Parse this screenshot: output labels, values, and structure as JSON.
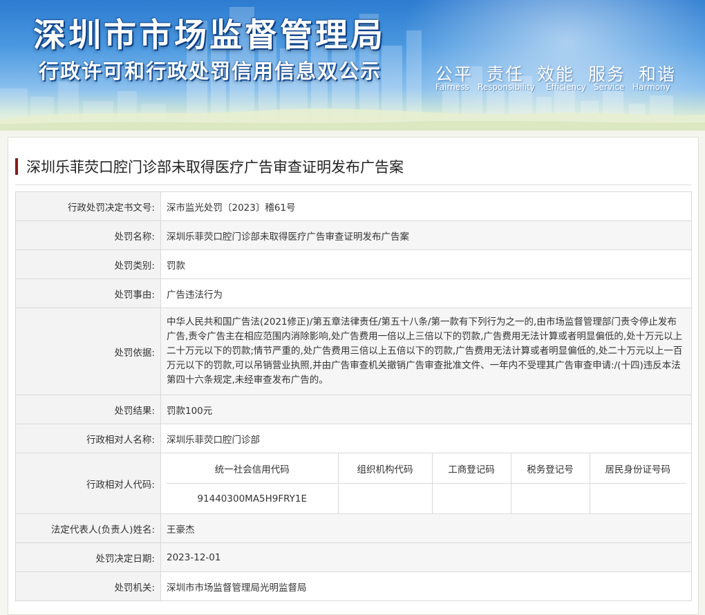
{
  "header": {
    "title": "深圳市市场监督管理局",
    "subtitle": "行政许可和行政处罚信用信息双公示",
    "slogans": [
      {
        "cn": "公平",
        "en": "Fairness"
      },
      {
        "cn": "责任",
        "en": "Responsibility"
      },
      {
        "cn": "效能",
        "en": "Efficiency"
      },
      {
        "cn": "服务",
        "en": "Service"
      },
      {
        "cn": "和谐",
        "en": "Harmony"
      }
    ]
  },
  "case": {
    "title": "深圳乐菲荧口腔门诊部未取得医疗广告审查证明发布广告案"
  },
  "fields": {
    "decision_no": {
      "label": "行政处罚决定书文号:",
      "value": "深市监光处罚〔2023〕稽61号"
    },
    "name": {
      "label": "处罚名称:",
      "value": "深圳乐菲荧口腔门诊部未取得医疗广告审查证明发布广告案"
    },
    "category": {
      "label": "处罚类别:",
      "value": "罚款"
    },
    "reason": {
      "label": "处罚事由:",
      "value": "广告违法行为"
    },
    "basis": {
      "label": "处罚依据:",
      "value": "中华人民共和国广告法(2021修正)/第五章法律责任/第五十八条/第一款有下列行为之一的,由市场监督管理部门责令停止发布广告,责令广告主在相应范围内消除影响,处广告费用一倍以上三倍以下的罚款,广告费用无法计算或者明显偏低的,处十万元以上二十万元以下的罚款;情节严重的,处广告费用三倍以上五倍以下的罚款,广告费用无法计算或者明显偏低的,处二十万元以上一百万元以下的罚款,可以吊销营业执照,并由广告审查机关撤销广告审查批准文件、一年内不受理其广告审查申请:/(十四)违反本法第四十六条规定,未经审查发布广告的。"
    },
    "result": {
      "label": "处罚结果:",
      "value": "罚款100元"
    },
    "party_name": {
      "label": "行政相对人名称:",
      "value": "深圳乐菲荧口腔门诊部"
    },
    "party_code": {
      "label": "行政相对人代码:",
      "headers": [
        "统一社会信用代码",
        "组织机构代码",
        "工商登记码",
        "税务登记号",
        "居民身份证号码"
      ],
      "values": [
        "91440300MA5H9FRY1E",
        "",
        "",
        "",
        ""
      ]
    },
    "legal_rep": {
      "label": "法定代表人(负责人)姓名:",
      "value": "王豪杰"
    },
    "decision_date": {
      "label": "处罚决定日期:",
      "value": "2023-12-01"
    },
    "authority": {
      "label": "处罚机关:",
      "value": "深圳市市场监督管理局光明监督局"
    }
  },
  "colors": {
    "title_accent": "#8b1a1a",
    "banner_top": "#2c7bd0",
    "label_bg": "#f3f3f3",
    "border": "#d9d9d9"
  }
}
